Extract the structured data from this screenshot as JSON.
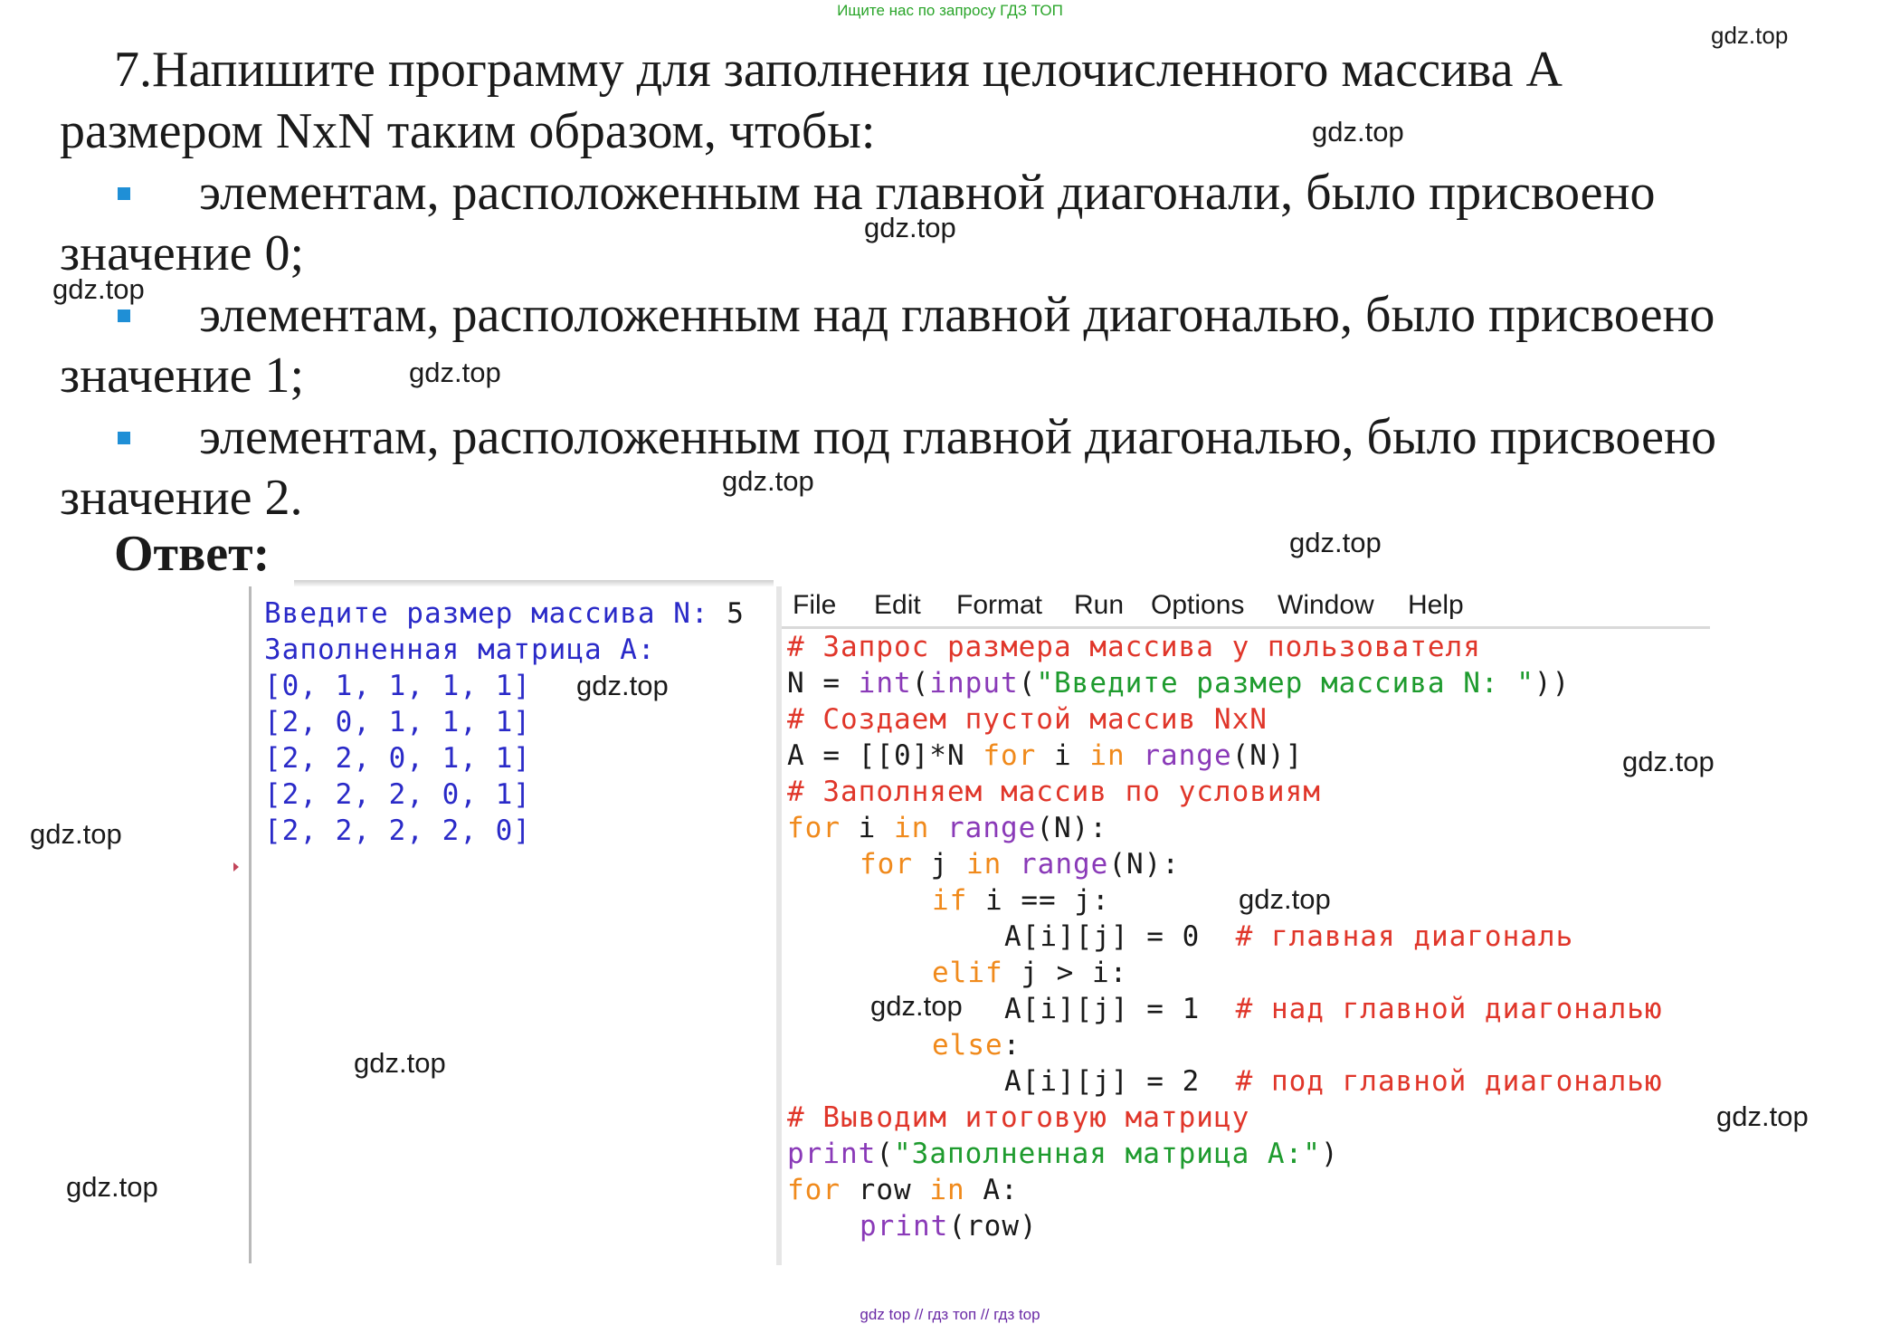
{
  "top_banner": "Ищите нас по запросу ГДЗ ТОП",
  "task": {
    "line1": "7.Напишите программу для заполнения целочисленного массива A",
    "line2": "размером NxN таким образом, чтобы:",
    "bullets": [
      {
        "line1": "элементам, расположенным на главной диагонали, было присвоено",
        "line2": "значение 0;"
      },
      {
        "line1": "элементам, расположенным над главной диагональю, было присвоено",
        "line2": "значение 1;"
      },
      {
        "line1": "элементам, расположенным под главной диагональю, было присвоено",
        "line2": "значение 2."
      }
    ]
  },
  "answer_label": "Ответ:",
  "watermark": "gdz.top",
  "footer": "gdz top // гдз топ // гдз top",
  "shell": {
    "prompt": "Введите размер массива N: ",
    "input_value": "5",
    "header": "Заполненная матрица A:",
    "rows": [
      "[0, 1, 1, 1, 1]",
      "[2, 0, 1, 1, 1]",
      "[2, 2, 0, 1, 1]",
      "[2, 2, 2, 0, 1]",
      "[2, 2, 2, 2, 0]"
    ]
  },
  "editor": {
    "menu": [
      "File",
      "Edit",
      "Format",
      "Run",
      "Options",
      "Window",
      "Help"
    ],
    "code": {
      "c1": "# Запрос размера массива у пользователя",
      "l2a": "N = ",
      "l2b": "int",
      "l2c": "(",
      "l2d": "input",
      "l2e": "(",
      "l2f": "\"Введите размер массива N: \"",
      "l2g": "))",
      "c3": "# Создаем пустой массив NxN",
      "l4a": "A = [[0]*N ",
      "l4b": "for",
      "l4c": " i ",
      "l4d": "in",
      "l4e": " ",
      "l4f": "range",
      "l4g": "(N)]",
      "c5": "# Заполняем массив по условиям",
      "l6a": "for",
      "l6b": " i ",
      "l6c": "in",
      "l6d": " ",
      "l6e": "range",
      "l6f": "(N):",
      "l7a": "for",
      "l7b": " j ",
      "l7c": "in",
      "l7d": " ",
      "l7e": "range",
      "l7f": "(N):",
      "l8a": "if",
      "l8b": " i == j:",
      "l9a": "A[i][j] = 0  ",
      "l9b": "# главная диагональ",
      "l10a": "elif",
      "l10b": " j > i:",
      "l11a": "A[i][j] = 1  ",
      "l11b": "# над главной диагональю",
      "l12a": "else",
      "l12b": ":",
      "l13a": "A[i][j] = 2  ",
      "l13b": "# под главной диагональю",
      "c14": "# Выводим итоговую матрицу",
      "l15a": "print",
      "l15b": "(",
      "l15c": "\"Заполненная матрица A:\"",
      "l15d": ")",
      "l16a": "for",
      "l16b": " row ",
      "l16c": "in",
      "l16d": " A:",
      "l17a": "print",
      "l17b": "(row)"
    }
  }
}
